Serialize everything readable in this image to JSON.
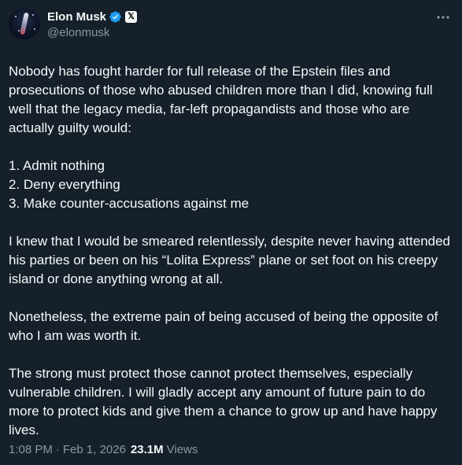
{
  "author": {
    "display_name": "Elon Musk",
    "handle": "@elonmusk",
    "affiliation_badge": "𝕏",
    "verified_color": "#1d9bf0"
  },
  "tweet": {
    "text": "Nobody has fought harder for full release of the Epstein files and prosecutions of those who abused children more than I did, knowing full well that the legacy media, far-left propagandists and those who are actually guilty would:\n\n1. Admit nothing\n2. Deny everything\n3. Make counter-accusations against me\n\nI knew that I would be smeared relentlessly, despite never having attended his parties or been on his “Lolita Express” plane or set foot on his creepy island or done anything wrong at all.\n\nNonetheless, the extreme pain of being accused of being the opposite of who I am was worth it.\n\nThe strong must protect those cannot protect themselves, especially vulnerable children. I will gladly accept any amount of future pain to do more to protect kids and give them a chance to grow up and have happy lives.",
    "time": "1:08 PM",
    "separator": "·",
    "date": "Feb 1, 2026",
    "views_count": "23.1M",
    "views_label": "Views"
  },
  "icons": {
    "more": "more-options-icon",
    "verified": "verified-badge-icon"
  }
}
